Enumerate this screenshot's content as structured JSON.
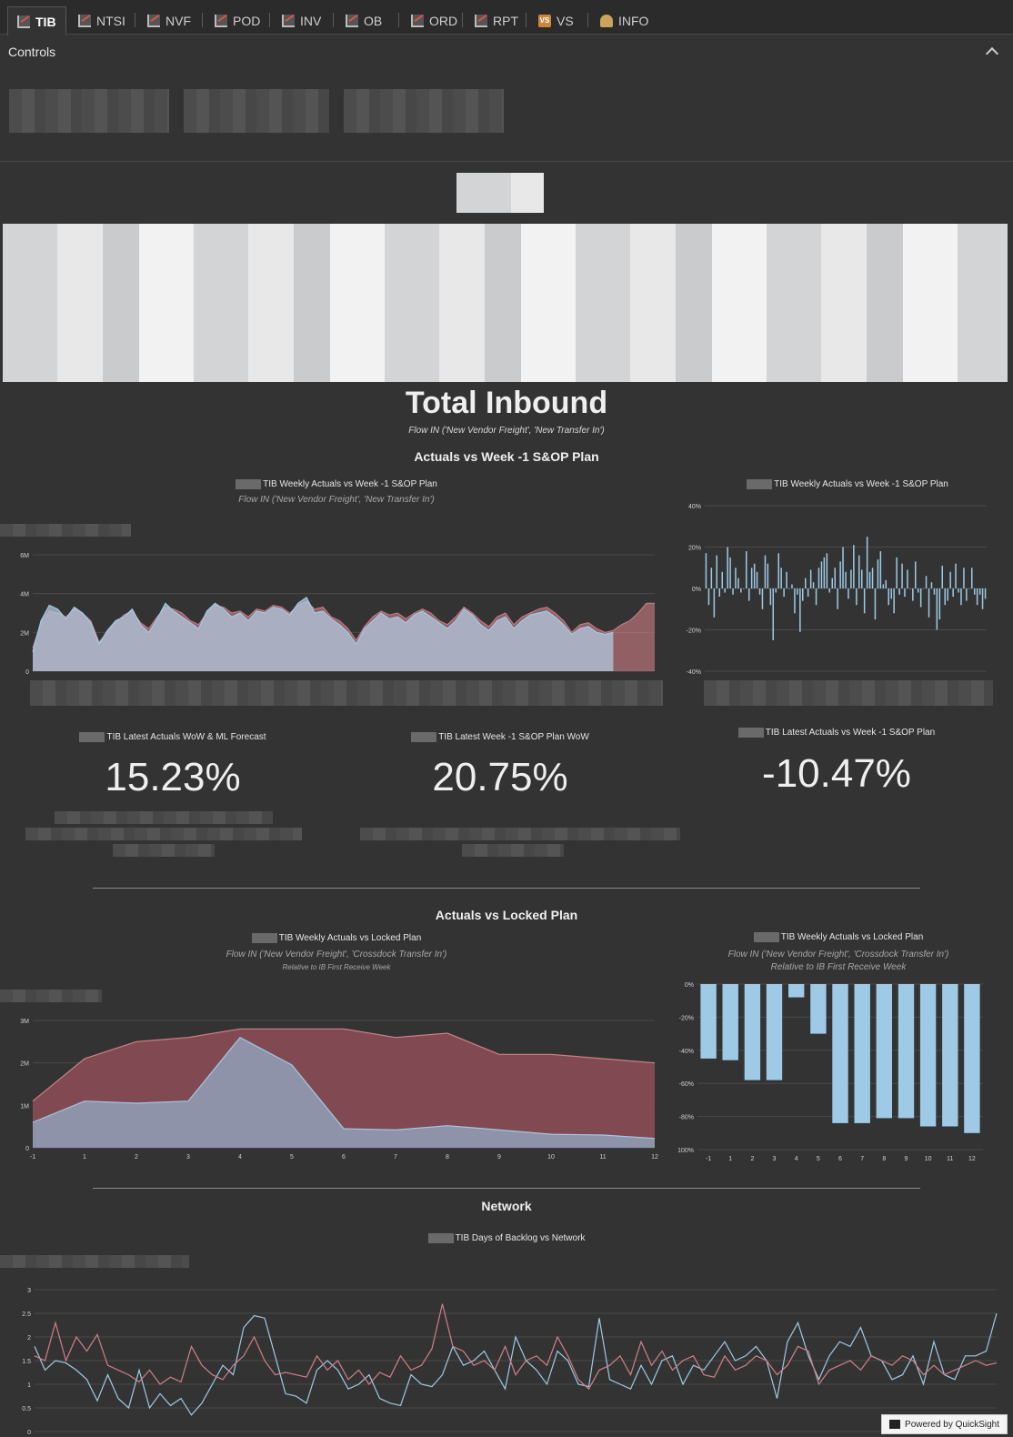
{
  "tabs": [
    {
      "label": "TIB",
      "icon": "chart-icon",
      "active": true
    },
    {
      "label": "NTSI",
      "icon": "chart-icon"
    },
    {
      "label": "NVF",
      "icon": "chart-icon"
    },
    {
      "label": "POD",
      "icon": "chart-icon"
    },
    {
      "label": "INV",
      "icon": "chart-icon"
    },
    {
      "label": "OB",
      "icon": "chart-icon"
    },
    {
      "label": "ORD",
      "icon": "chart-icon"
    },
    {
      "label": "RPT",
      "icon": "report-icon"
    },
    {
      "label": "VS",
      "icon": "vs-icon"
    },
    {
      "label": "INFO",
      "icon": "info-icon"
    }
  ],
  "controls": {
    "title": "Controls"
  },
  "header": {
    "title": "Total Inbound",
    "subtitle": "Flow IN ('New Vendor Freight', 'New Transfer In')"
  },
  "sections": {
    "sop": "Actuals vs Week -1 S&OP Plan",
    "locked": "Actuals vs Locked Plan",
    "network": "Network"
  },
  "visuals": {
    "weekly_sop": {
      "title": "TIB Weekly Actuals vs Week -1 S&OP Plan",
      "subtitle": "Flow IN ('New Vendor Freight', 'New Transfer In')"
    },
    "weekly_sop_pct": {
      "title": "TIB Weekly Actuals vs Week -1 S&OP Plan"
    },
    "kpi1": {
      "title": "TIB Latest Actuals WoW & ML Forecast",
      "value": "15.23%"
    },
    "kpi2": {
      "title": "TIB Latest Week -1 S&OP Plan WoW",
      "value": "20.75%"
    },
    "kpi3": {
      "title": "TIB Latest Actuals vs Week -1 S&OP Plan",
      "value": "-10.47%"
    },
    "weekly_locked": {
      "title": "TIB Weekly Actuals vs Locked Plan",
      "subtitle": "Flow IN ('New Vendor Freight', 'Crossdock Transfer In')",
      "subtitle2": "Relative to IB First Receive Week"
    },
    "weekly_locked_pct": {
      "title": "TIB Weekly Actuals vs Locked Plan",
      "subtitle": "Flow IN ('New Vendor Freight', 'Crossdock Transfer In')",
      "subtitle2": "Relative to IB First Receive Week"
    },
    "backlog": {
      "title": "TIB Days of Backlog vs Network"
    }
  },
  "footer": {
    "powered_by": "Powered by QuickSight"
  },
  "colors": {
    "actual": "#9ecae6",
    "plan": "#d07f87",
    "bg": "#333333"
  },
  "chart_data": [
    {
      "type": "area",
      "ylim": [
        0,
        6000000
      ],
      "yticks": [
        "0",
        "2M",
        "4M",
        "6M"
      ],
      "series": [
        {
          "values": [
            1.2,
            2.5,
            3.1,
            3.0,
            2.8,
            3.2,
            3.0,
            2.6,
            1.5,
            2.0,
            2.5,
            2.9,
            3.1,
            2.5,
            2.2,
            2.8,
            3.3,
            3.2,
            3.0,
            2.6,
            2.4,
            3.0,
            3.4,
            3.3,
            3.0,
            3.1,
            2.8,
            3.2,
            3.1,
            3.4,
            3.3,
            3.0,
            3.4,
            3.6,
            3.2,
            3.3,
            2.8,
            2.6,
            2.2,
            1.6,
            2.3,
            2.8,
            3.1,
            2.9,
            3.0,
            2.7,
            3.0,
            3.2,
            3.0,
            2.6,
            2.4,
            2.8,
            3.3,
            3.0,
            2.6,
            2.3,
            2.8,
            3.0,
            2.4,
            2.8,
            3.0,
            3.2,
            3.3,
            3.0,
            2.6,
            2.0,
            2.4,
            2.5,
            2.2,
            2.0,
            2.1,
            2.4,
            2.6,
            3.0,
            3.5,
            3.5
          ]
        },
        {
          "values": [
            1.0,
            2.6,
            3.4,
            3.2,
            2.7,
            3.3,
            3.0,
            2.5,
            1.4,
            2.1,
            2.6,
            2.8,
            3.2,
            2.4,
            2.0,
            2.7,
            3.5,
            3.1,
            2.8,
            2.5,
            2.2,
            3.1,
            3.5,
            3.2,
            2.8,
            3.0,
            2.6,
            3.1,
            3.0,
            3.3,
            3.2,
            2.9,
            3.5,
            3.8,
            3.0,
            3.1,
            2.7,
            2.4,
            2.0,
            1.4,
            2.2,
            2.6,
            3.0,
            2.7,
            2.8,
            2.5,
            2.9,
            3.1,
            2.8,
            2.5,
            2.2,
            2.6,
            3.2,
            2.9,
            2.4,
            2.1,
            2.6,
            2.8,
            2.2,
            2.6,
            2.9,
            3.0,
            3.1,
            2.8,
            2.4,
            1.9,
            2.2,
            2.3,
            2.0,
            1.9,
            2.0,
            null,
            null,
            null,
            null,
            null
          ]
        }
      ]
    },
    {
      "type": "bar",
      "ylim": [
        -40,
        40
      ],
      "yticks": [
        "-40%",
        "-20%",
        "0%",
        "20%",
        "40%"
      ],
      "values": [
        17,
        -8,
        10,
        -14,
        16,
        -4,
        8,
        -2,
        20,
        15,
        -3,
        10,
        5,
        -2,
        0,
        18,
        -6,
        10,
        12,
        8,
        -3,
        -10,
        16,
        12,
        -8,
        -25,
        -2,
        17,
        10,
        -4,
        8,
        0,
        2,
        -12,
        -3,
        -21,
        -6,
        5,
        -4,
        9,
        3,
        -8,
        10,
        13,
        15,
        17,
        -2,
        5,
        10,
        -10,
        13,
        20,
        8,
        -5,
        9,
        21,
        -8,
        16,
        9,
        -12,
        25,
        8,
        10,
        -15,
        14,
        18,
        2,
        4,
        -8,
        -5,
        -12,
        15,
        -3,
        12,
        -4,
        9,
        0,
        -6,
        13,
        -2,
        -9,
        0,
        6,
        -14,
        3,
        -3,
        -20,
        -15,
        11,
        -8,
        -6,
        8,
        -4,
        12,
        -2,
        -8,
        10,
        -6,
        0,
        10,
        -3,
        -8,
        -3,
        -10,
        -5
      ],
      "series_color": "#9ecae6"
    },
    {
      "type": "area",
      "categories": [
        "-1",
        "1",
        "2",
        "3",
        "4",
        "5",
        "6",
        "7",
        "8",
        "9",
        "10",
        "11",
        "12"
      ],
      "ylim": [
        0,
        3000000
      ],
      "yticks": [
        "0",
        "1M",
        "2M",
        "3M"
      ],
      "series": [
        {
          "values": [
            1.1,
            2.1,
            2.5,
            2.6,
            2.8,
            2.8,
            2.8,
            2.6,
            2.7,
            2.2,
            2.2,
            2.1,
            2.0
          ]
        },
        {
          "values": [
            0.6,
            1.1,
            1.05,
            1.1,
            2.6,
            1.95,
            0.45,
            0.42,
            0.52,
            0.42,
            0.32,
            0.3,
            0.22
          ]
        }
      ]
    },
    {
      "type": "bar",
      "categories": [
        "-1",
        "1",
        "2",
        "3",
        "4",
        "5",
        "6",
        "7",
        "8",
        "9",
        "10",
        "11",
        "12"
      ],
      "ylim": [
        -100,
        0
      ],
      "yticks": [
        "0%",
        "-20%",
        "-40%",
        "-60%",
        "-80%",
        "-100%"
      ],
      "values": [
        -45,
        -46,
        -58,
        -58,
        -8,
        -30,
        -84,
        -84,
        -81,
        -81,
        -86,
        -86,
        -90
      ]
    },
    {
      "type": "line",
      "ylim": [
        0,
        3
      ],
      "yticks": [
        "0",
        "0.5",
        "1",
        "1.5",
        "2",
        "2.5",
        "3"
      ],
      "series": [
        {
          "values": [
            1.8,
            1.3,
            1.5,
            1.45,
            1.3,
            1.1,
            0.65,
            1.2,
            0.7,
            0.5,
            1.3,
            0.5,
            0.8,
            0.55,
            0.7,
            0.35,
            0.6,
            1.0,
            1.4,
            1.2,
            2.2,
            2.45,
            2.4,
            1.6,
            0.8,
            0.75,
            0.6,
            1.3,
            1.5,
            1.3,
            0.9,
            1.0,
            1.2,
            0.7,
            0.6,
            0.55,
            1.2,
            1.0,
            0.95,
            1.2,
            1.8,
            1.4,
            1.5,
            1.7,
            1.3,
            0.9,
            2.0,
            1.5,
            1.3,
            1.0,
            1.7,
            1.5,
            1.0,
            0.95,
            2.4,
            1.1,
            1.0,
            0.9,
            1.4,
            1.0,
            1.5,
            1.6,
            1.0,
            1.4,
            1.3,
            1.6,
            1.9,
            1.5,
            1.6,
            1.8,
            1.5,
            0.7,
            1.9,
            2.3,
            1.6,
            1.1,
            1.6,
            1.9,
            1.8,
            2.2,
            1.6,
            1.5,
            1.1,
            1.2,
            1.6,
            1.0,
            1.9,
            1.2,
            1.1,
            1.6,
            1.6,
            1.7,
            2.5
          ]
        },
        {
          "values": [
            1.6,
            1.5,
            2.3,
            1.5,
            2.0,
            1.7,
            2.05,
            1.4,
            1.3,
            1.2,
            1.05,
            1.3,
            1.0,
            1.15,
            1.05,
            1.8,
            1.4,
            1.2,
            1.1,
            1.4,
            1.6,
            2.0,
            1.5,
            1.2,
            1.25,
            1.2,
            1.15,
            1.6,
            1.3,
            1.5,
            1.1,
            1.3,
            1.0,
            1.25,
            1.15,
            1.6,
            1.3,
            1.4,
            1.75,
            2.7,
            1.8,
            1.7,
            1.4,
            1.5,
            1.3,
            1.8,
            1.2,
            1.5,
            1.6,
            1.4,
            2.0,
            1.6,
            1.1,
            0.9,
            1.3,
            1.4,
            1.6,
            1.2,
            1.9,
            1.4,
            1.7,
            1.3,
            1.5,
            1.6,
            1.2,
            1.15,
            1.6,
            1.3,
            1.4,
            1.6,
            1.5,
            1.2,
            1.4,
            1.8,
            1.7,
            1.0,
            1.3,
            1.4,
            1.5,
            1.3,
            1.6,
            1.5,
            1.4,
            1.6,
            1.5,
            1.2,
            1.4,
            1.2,
            1.3,
            1.4,
            1.5,
            1.4,
            1.45
          ]
        }
      ]
    }
  ]
}
